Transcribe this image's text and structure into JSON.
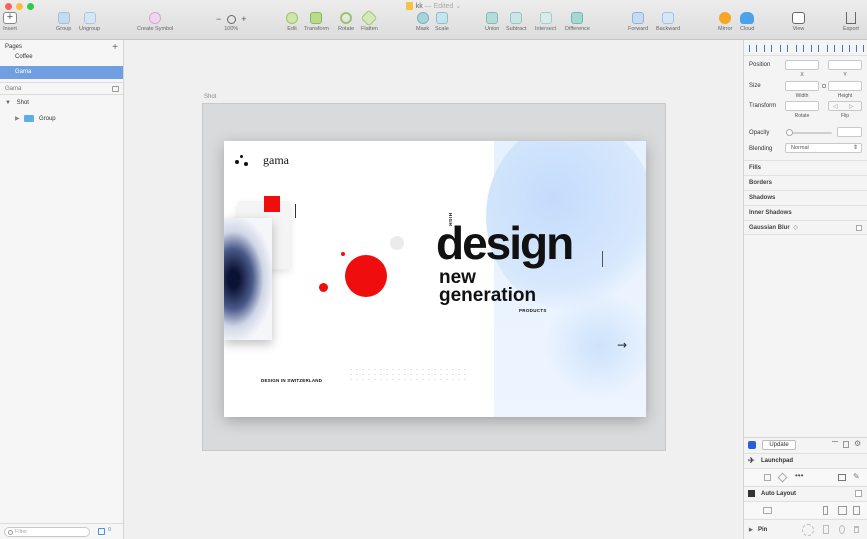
{
  "window": {
    "doc_name": "kk",
    "edited_label": "— Edited",
    "traffic_lights": [
      "#fc605c",
      "#fdbc40",
      "#34c84a"
    ]
  },
  "toolbar": {
    "insert": "Insert",
    "group": "Group",
    "ungroup": "Ungroup",
    "create_symbol": "Create Symbol",
    "zoom_minus": "−",
    "zoom_plus": "+",
    "zoom_value": "100%",
    "edit": "Edit",
    "transform": "Transform",
    "rotate": "Rotate",
    "flatten": "Flatten",
    "mask": "Mask",
    "scale": "Scale",
    "union": "Union",
    "subtract": "Subtract",
    "intersect": "Intersect",
    "difference": "Difference",
    "forward": "Forward",
    "backward": "Backward",
    "mirror": "Mirror",
    "cloud": "Cloud",
    "view": "View",
    "export": "Export"
  },
  "layers": {
    "pages_header": "Pages",
    "add_page": "+",
    "pages": [
      {
        "label": "Coffee"
      },
      {
        "label": "Gama"
      }
    ],
    "current_page": "Gama",
    "tree": [
      {
        "label": "Shot"
      },
      {
        "label": "Group"
      }
    ],
    "filter_placeholder": "Filter",
    "symbol_count": "0"
  },
  "canvas": {
    "artboard_label": "Shot",
    "card": {
      "logo_text": "gama",
      "vertical_label": "HIGH",
      "headline": "design",
      "line2": "new",
      "line3": "generation",
      "products_label": "PRODUCTS",
      "footer_text": "DESIGN IN SWITZERLAND",
      "arrow": "→",
      "accent": "#f00d0d",
      "panel_color": "#dfeeff"
    }
  },
  "inspector": {
    "position_label": "Position",
    "x_label": "X",
    "y_label": "Y",
    "size_label": "Size",
    "width_label": "Width",
    "height_label": "Height",
    "transform_label": "Transform",
    "rotate_label": "Rotate",
    "flip_label": "Flip",
    "opacity_label": "Opacity",
    "blending_label": "Blending",
    "blending_value": "Normal",
    "fills": "Fills",
    "borders": "Borders",
    "shadows": "Shadows",
    "inner_shadows": "Inner Shadows",
    "gaussian_blur": "Gaussian Blur",
    "gaussian_chevron": "◇"
  },
  "plugins": {
    "update_button": "Update",
    "launchpad": "Launchpad",
    "auto_layout": "Auto Layout",
    "pin": "Pin"
  }
}
